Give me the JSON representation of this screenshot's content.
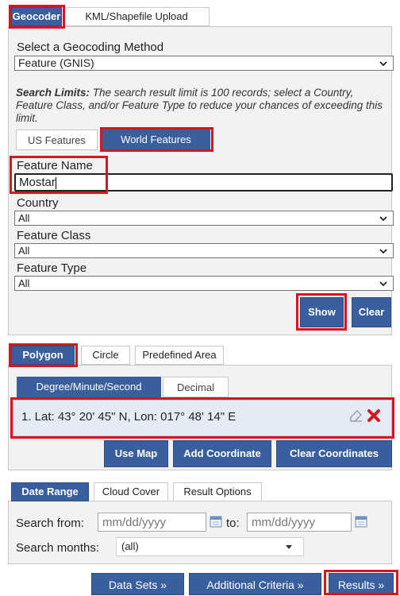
{
  "geocoder": {
    "tabs": [
      "Geocoder",
      "KML/Shapefile Upload"
    ],
    "method_label": "Select a Geocoding Method",
    "method_value": "Feature (GNIS)",
    "limits_title": "Search Limits:",
    "limits_text": " The search result limit is 100 records; select a Country, Feature Class, and/or Feature Type to reduce your chances of exceeding this limit.",
    "feature_tabs": [
      "US Features",
      "World Features"
    ],
    "feature_name_label": "Feature Name",
    "feature_name_value": "Mostar",
    "country_label": "Country",
    "country_value": "All",
    "class_label": "Feature Class",
    "class_value": "All",
    "type_label": "Feature Type",
    "type_value": "All",
    "show_label": "Show",
    "clear_label": "Clear"
  },
  "area": {
    "tabs": [
      "Polygon",
      "Circle",
      "Predefined Area"
    ],
    "format_tabs": [
      "Degree/Minute/Second",
      "Decimal"
    ],
    "coordinate": "1.  Lat: 43° 20' 45\" N, Lon: 017° 48' 14\" E",
    "buttons": [
      "Use Map",
      "Add Coordinate",
      "Clear Coordinates"
    ]
  },
  "dates": {
    "tabs": [
      "Date Range",
      "Cloud Cover",
      "Result Options"
    ],
    "from_label": "Search from:",
    "from_placeholder": "mm/dd/yyyy",
    "to_label": "to:",
    "to_placeholder": "mm/dd/yyyy",
    "months_label": "Search months:",
    "months_value": "(all)"
  },
  "nav": {
    "buttons": [
      "Data Sets »",
      "Additional Criteria »",
      "Results »"
    ]
  },
  "colors": {
    "accent": "#3a5f9e",
    "highlight": "#d6161f"
  }
}
